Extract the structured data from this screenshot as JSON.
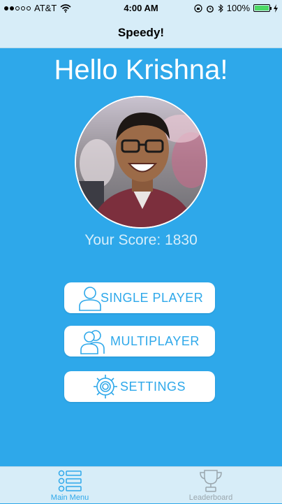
{
  "status_bar": {
    "carrier": "AT&T",
    "time": "4:00 AM",
    "battery": "100%",
    "battery_level": 1.0,
    "signal_bars_filled": 2,
    "signal_bars_total": 5
  },
  "nav": {
    "title": "Speedy!"
  },
  "main": {
    "greeting": "Hello Krishna!",
    "score_label": "Your Score: 1830"
  },
  "menu": {
    "single_player": "SINGLE PLAYER",
    "multiplayer": "MULTIPLAYER",
    "settings": "SETTINGS"
  },
  "tabs": {
    "main_menu": "Main Menu",
    "leaderboard": "Leaderboard"
  },
  "colors": {
    "background": "#2ea8ea",
    "bars": "#d7edf8",
    "accent": "#2ea8ea",
    "inactive_tab": "#9aa6ad"
  },
  "icons": {
    "single_player": "person-outline-icon",
    "multiplayer": "people-outline-icon",
    "settings": "gear-icon",
    "main_menu": "list-icon",
    "leaderboard": "trophy-icon"
  }
}
